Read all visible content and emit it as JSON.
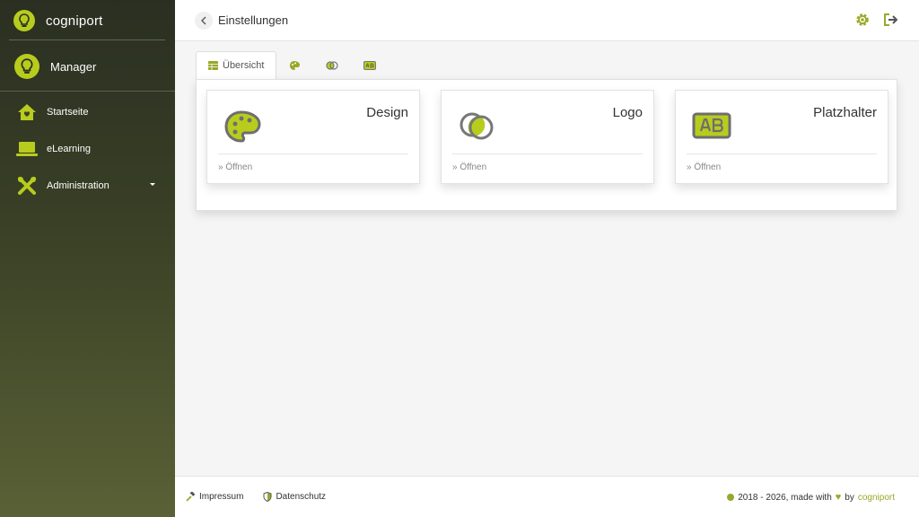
{
  "app": {
    "name": "cogniport"
  },
  "user": {
    "name": "Manager"
  },
  "nav": [
    {
      "label": "Startseite",
      "icon": "home-icon"
    },
    {
      "label": "eLearning",
      "icon": "laptop-icon"
    },
    {
      "label": "Administration",
      "icon": "tools-icon"
    }
  ],
  "header": {
    "title": "Einstellungen",
    "icons": [
      "gear-icon",
      "logout-icon"
    ]
  },
  "tabs": [
    {
      "label": "Übersicht",
      "icon": "table-icon",
      "active": true
    },
    {
      "label": "",
      "icon": "palette-icon"
    },
    {
      "label": "",
      "icon": "circles-icon"
    },
    {
      "label": "",
      "icon": "text-box-icon"
    }
  ],
  "cards": [
    {
      "title": "Design",
      "link": "» Öffnen",
      "icon": "palette-icon"
    },
    {
      "title": "Logo",
      "link": "» Öffnen",
      "icon": "circles-icon"
    },
    {
      "title": "Platzhalter",
      "link": "» Öffnen",
      "icon": "text-box-icon"
    }
  ],
  "footer": {
    "impressum": "Impressum",
    "datenschutz": "Datenschutz",
    "copyright": "2018 - 2026, made with",
    "by": "by",
    "brand": "cogniport"
  },
  "colors": {
    "accent": "#9aa829",
    "accent_light": "#b8cc1e",
    "sidebar_top": "#2a2f22",
    "sidebar_bottom": "#5a6136"
  }
}
